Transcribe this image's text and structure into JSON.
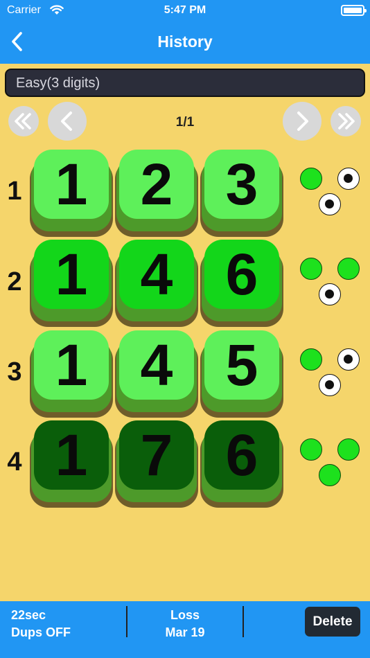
{
  "status_bar": {
    "carrier": "Carrier",
    "time": "5:47 PM"
  },
  "nav": {
    "title": "History",
    "back_icon": "chevron-left-icon"
  },
  "difficulty": {
    "value": "Easy(3 digits)"
  },
  "pagination": {
    "label": "1/1"
  },
  "rows": [
    {
      "number": "1",
      "digits": [
        "1",
        "2",
        "3"
      ],
      "tile_color": "#5ef05a",
      "pegs": [
        "green",
        "white",
        "white"
      ]
    },
    {
      "number": "2",
      "digits": [
        "1",
        "4",
        "6"
      ],
      "tile_color": "#13d61a",
      "pegs": [
        "green",
        "green",
        "white"
      ]
    },
    {
      "number": "3",
      "digits": [
        "1",
        "4",
        "5"
      ],
      "tile_color": "#5ef05a",
      "pegs": [
        "green",
        "white",
        "white"
      ]
    },
    {
      "number": "4",
      "digits": [
        "1",
        "7",
        "6"
      ],
      "tile_color": "#0a5e0a",
      "pegs": [
        "green",
        "green",
        "green"
      ]
    }
  ],
  "footer": {
    "duration": "22sec",
    "dups": "Dups OFF",
    "result": "Loss",
    "date": "Mar 19",
    "delete_label": "Delete"
  },
  "colors": {
    "header_blue": "#2196f3",
    "background": "#f5d56b",
    "peg_green": "#1de11d"
  }
}
